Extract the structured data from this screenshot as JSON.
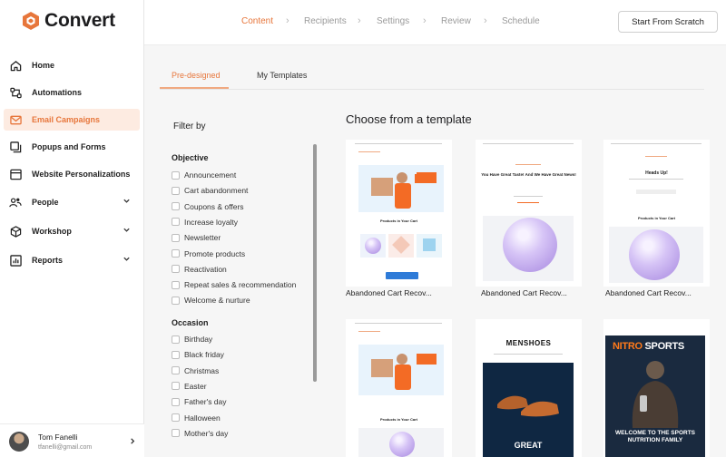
{
  "app": {
    "name": "Convert",
    "accent": "#e7763b"
  },
  "sidebar": {
    "items": [
      {
        "label": "Home",
        "icon": "home-icon"
      },
      {
        "label": "Automations",
        "icon": "automations-icon"
      },
      {
        "label": "Email Campaigns",
        "icon": "mail-icon",
        "active": true
      },
      {
        "label": "Popups and Forms",
        "icon": "popup-icon"
      },
      {
        "label": "Website Personalizations",
        "icon": "browser-icon"
      },
      {
        "label": "People",
        "icon": "people-icon"
      },
      {
        "label": "Workshop",
        "icon": "cube-icon"
      },
      {
        "label": "Reports",
        "icon": "reports-icon"
      }
    ],
    "user": {
      "name": "Tom Fanelli",
      "email": "tfanelli@gmail.com"
    }
  },
  "header": {
    "steps": [
      "Content",
      "Recipients",
      "Settings",
      "Review",
      "Schedule"
    ],
    "active_step": "Content",
    "scratch_button": "Start From Scratch"
  },
  "tabs": [
    "Pre-designed",
    "My Templates"
  ],
  "filter": {
    "title": "Filter by",
    "objective_title": "Objective",
    "objective": [
      "Announcement",
      "Cart abandonment",
      "Coupons & offers",
      "Increase loyalty",
      "Newsletter",
      "Promote products",
      "Reactivation",
      "Repeat sales & recommendation",
      "Welcome & nurture"
    ],
    "occasion_title": "Occasion",
    "occasion": [
      "Birthday",
      "Black friday",
      "Christmas",
      "Easter",
      "Father's day",
      "Halloween",
      "Mother's day"
    ]
  },
  "templates": {
    "title": "Choose from a template",
    "cards": [
      {
        "name": "Abandoned Cart Recov..."
      },
      {
        "name": "Abandoned Cart Recov..."
      },
      {
        "name": "Abandoned Cart Recov..."
      }
    ],
    "preview_text": {
      "products_in_cart": "Products in Your Cart",
      "cart_headline": "You Have Great Taste! And We Have Great News!",
      "heads_up": "Heads Up!",
      "menshoes": "MENSHOES",
      "great": "GREAT",
      "nitro_1": "NITRO",
      "nitro_2": "SPORTS",
      "welcome": "WELCOME TO THE SPORTS NUTRITION FAMILY"
    }
  }
}
